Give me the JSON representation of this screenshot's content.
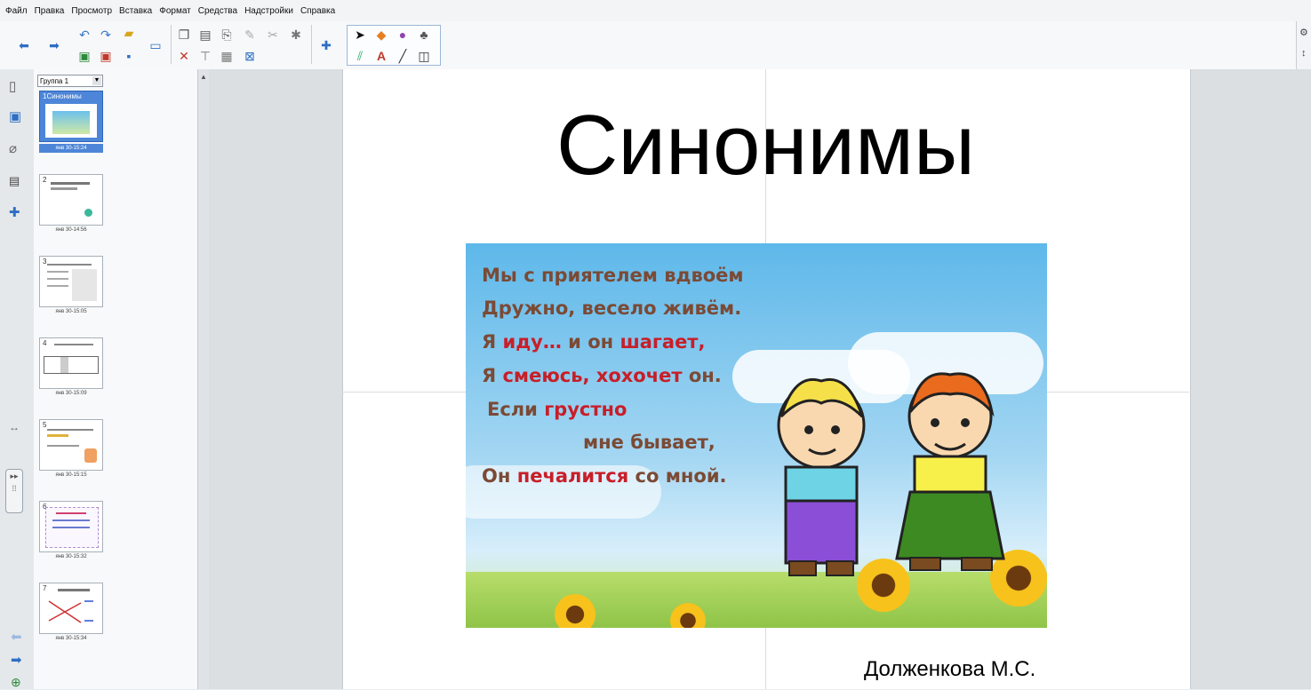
{
  "menu": [
    "Файл",
    "Правка",
    "Просмотр",
    "Вставка",
    "Формат",
    "Средства",
    "Надстройки",
    "Справка"
  ],
  "group_select": "Группа 1",
  "slides": [
    {
      "num": "1",
      "label": "Синонимы",
      "time": "янв 30-15:24",
      "selected": true
    },
    {
      "num": "2",
      "label": "",
      "time": "янв 30-14:56",
      "selected": false
    },
    {
      "num": "3",
      "label": "",
      "time": "янв 30-15:05",
      "selected": false
    },
    {
      "num": "4",
      "label": "",
      "time": "янв 30-15:09",
      "selected": false
    },
    {
      "num": "5",
      "label": "",
      "time": "янв 30-15:15",
      "selected": false
    },
    {
      "num": "6",
      "label": "",
      "time": "янв 30-15:32",
      "selected": false
    },
    {
      "num": "7",
      "label": "",
      "time": "янв 30-15:34",
      "selected": false
    }
  ],
  "slide": {
    "title": "Синонимы",
    "author": "Долженкова М.С.",
    "poem": {
      "l1": "Мы с приятелем вдвоём",
      "l2": "Дружно, весело живём.",
      "l3a": "Я ",
      "l3b": "иду…",
      "l3c": "  и он ",
      "l3d": "шагает,",
      "l4a": "Я ",
      "l4b": "смеюсь, хохочет",
      "l4c": " он.",
      "l5a": "Если ",
      "l5b": "грустно",
      "l6": "мне бывает,",
      "l7a": "Он ",
      "l7b": "печалится",
      "l7c": " со мной."
    }
  },
  "colors": {
    "accent": "#4d86d8",
    "poem_text": "#7b4a35",
    "poem_highlight": "#c81e28"
  }
}
